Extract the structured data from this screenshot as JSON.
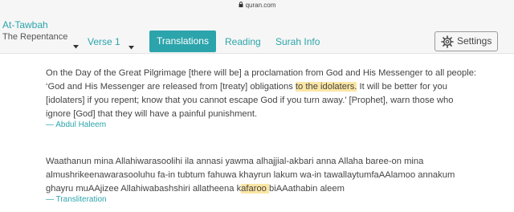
{
  "browser": {
    "url": "quran.com"
  },
  "header": {
    "surah_name": "At-Tawbah",
    "surah_subtitle": "The Repentance",
    "verse_label": "Verse 1",
    "tabs": [
      {
        "label": "Translations",
        "active": true
      },
      {
        "label": "Reading",
        "active": false
      },
      {
        "label": "Surah Info",
        "active": false
      }
    ],
    "settings_label": "Settings"
  },
  "translation": {
    "part1": "On the Day of the Great Pilgrimage [there will be] a proclamation from God and His Messenger to all people:",
    "part2_before": "‘God and His Messenger are released from [treaty] obligations ",
    "part2_highlight": "to the idolaters.",
    "part2_after": " It will be better for you",
    "part3": "[idolaters] if you repent; know that you cannot escape God if you turn away.’ [Prophet], warn those who",
    "part4": "ignore [God] that they will have a painful punishment.",
    "author": "— Abdul Haleem"
  },
  "transliteration": {
    "line1": "Waathanun mina Allahiwarasoolihi ila annasi yawma alhajjial-akbari anna Allaha baree-on mina",
    "line2": "almushrikeenawarasooluhu fa-in tubtum fahuwa khayrun lakum wa-in tawallaytumfaAAlamoo annakum",
    "line3_before": "ghayru muAAjizee Allahiwabashshiri allatheena k",
    "line3_highlight": "afaroo ",
    "line3_after": "biAAathabin aleem",
    "author": "— Transliteration"
  },
  "colors": {
    "accent": "#2ca4ab",
    "highlight": "#fbe6a4"
  }
}
